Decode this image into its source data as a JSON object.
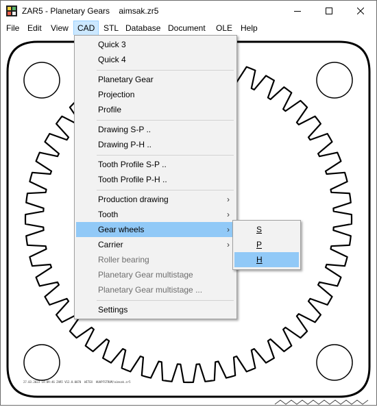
{
  "window": {
    "title": "ZAR5 - Planetary Gears    aimsak.zr5",
    "controls": [
      "minimize-icon",
      "maximize-icon",
      "close-icon"
    ]
  },
  "menubar": {
    "items": [
      {
        "label": "File"
      },
      {
        "label": "Edit"
      },
      {
        "label": "View"
      },
      {
        "label": "CAD",
        "active": true
      },
      {
        "label": "STL"
      },
      {
        "label": "Database"
      },
      {
        "label": "Document"
      },
      {
        "label": "OLE"
      },
      {
        "label": "Help"
      }
    ]
  },
  "cad_menu": {
    "groups": [
      [
        {
          "label": "Quick 3",
          "enabled": true
        },
        {
          "label": "Quick 4",
          "enabled": true
        }
      ],
      [
        {
          "label": "Planetary Gear",
          "enabled": true
        },
        {
          "label": "Projection",
          "enabled": true
        },
        {
          "label": "Profile",
          "enabled": true
        }
      ],
      [
        {
          "label": "Drawing S-P ..",
          "enabled": true
        },
        {
          "label": "Drawing P-H ..",
          "enabled": true
        }
      ],
      [
        {
          "label": "Tooth Profile S-P ..",
          "enabled": true
        },
        {
          "label": "Tooth Profile P-H ..",
          "enabled": true
        }
      ],
      [
        {
          "label": "Production drawing",
          "enabled": true,
          "submenu": true
        },
        {
          "label": "Tooth",
          "enabled": true,
          "submenu": true
        },
        {
          "label": "Gear wheels",
          "enabled": true,
          "submenu": true,
          "highlighted": true
        },
        {
          "label": "Carrier",
          "enabled": true,
          "submenu": true
        },
        {
          "label": "Roller bearing",
          "enabled": false
        },
        {
          "label": "Planetary Gear multistage",
          "enabled": false
        },
        {
          "label": "Planetary Gear multistage ...",
          "enabled": false
        }
      ],
      [
        {
          "label": "Settings",
          "enabled": true
        }
      ]
    ]
  },
  "gear_wheels_submenu": {
    "items": [
      {
        "label": "S"
      },
      {
        "label": "P"
      },
      {
        "label": "H",
        "highlighted": true
      }
    ]
  },
  "drawing": {
    "footer_text": "27.03.2023 14:09:46 ZAR5 V12.0.0070  WITEX  HUAPFSTRUM/aimsak.zr5",
    "stroke_color": "#000000",
    "menu_highlight_color": "#91c9f7"
  }
}
